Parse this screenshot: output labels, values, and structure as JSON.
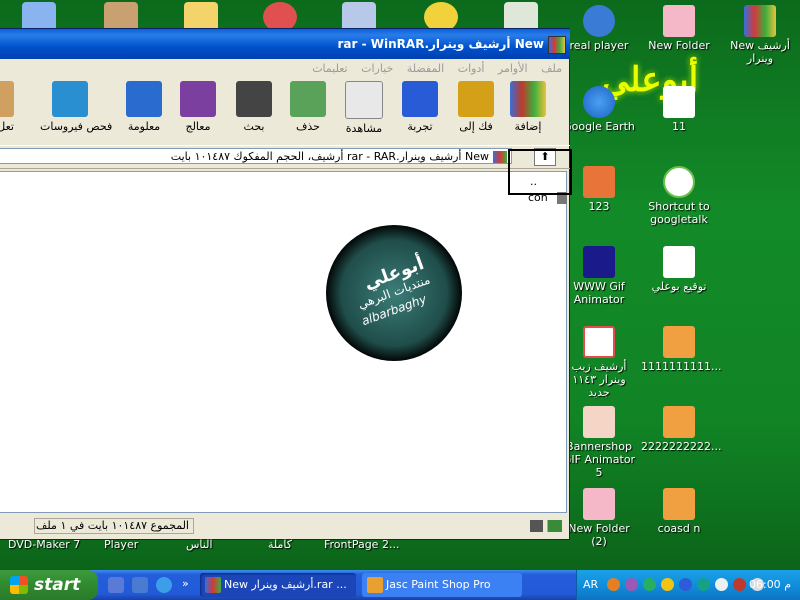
{
  "desktop": {
    "logo_text": "أبوعلي",
    "icons": [
      {
        "label": "real player",
        "color": "#3a7bd5"
      },
      {
        "label": "New Folder",
        "color": "#f4b8c9"
      },
      {
        "label": "New أرشيف وينرار",
        "color": "#8a4fd8"
      },
      {
        "label": "Google Earth",
        "color": "#1c62c8"
      },
      {
        "label": "11",
        "color": "#ffffff"
      },
      {
        "label": "123",
        "color": "#e8743a"
      },
      {
        "label": "Shortcut to googletalk",
        "color": "#6cc04a"
      },
      {
        "label": "WWW Gif Animator",
        "color": "#1a1a8a"
      },
      {
        "label": "توقيع بوعلي",
        "color": "#ffffff"
      },
      {
        "label": "أرشيف زيب وينرار ١١٤٣ جديد",
        "color": "#e84a4a"
      },
      {
        "label": "1111111111...",
        "color": "#f0a040"
      },
      {
        "label": "Bannershop GIF Animator 5",
        "color": "#f5d5c5"
      },
      {
        "label": "2222222222...",
        "color": "#f0a040"
      },
      {
        "label": "New Folder (2)",
        "color": "#f4b8c9"
      },
      {
        "label": "coasd n",
        "color": "#f0a040"
      }
    ],
    "quick_labels": [
      "DVD-Maker 7",
      "Player",
      "الناس",
      "كاملة",
      "FrontPage 2..."
    ]
  },
  "window": {
    "title": "New أرشيف وينرار.rar - WinRAR",
    "menu": [
      "ملف",
      "الأوامر",
      "أدوات",
      "المفضلة",
      "خيارات",
      "تعليمات"
    ],
    "toolbar": [
      {
        "label": "إضافة",
        "color": "#c0392b"
      },
      {
        "label": "فك إلى",
        "color": "#d4a017"
      },
      {
        "label": "تجربة",
        "color": "#2a5bd7"
      },
      {
        "label": "مشاهدة",
        "color": "#e8e8e8"
      },
      {
        "label": "حذف",
        "color": "#5aa15a"
      },
      {
        "label": "بحث",
        "color": "#444444"
      },
      {
        "label": "معالج",
        "color": "#7b3fa0"
      },
      {
        "label": "معلومة",
        "color": "#2a6bd0"
      },
      {
        "label": "فحص فيروسات",
        "color": "#2a8fd0"
      },
      {
        "label": "تعل",
        "color": "#d0a060"
      }
    ],
    "address": "New أرشيف وينرار.rar - RAR أرشيف، الحجم المفكوك ١٠١٤٨٧ بايت",
    "files": [
      "..",
      "con"
    ],
    "badge": {
      "line1": "أبوعلي",
      "line2": "منتديات البرهي",
      "line3": "albarbaghy"
    },
    "status": "المجموع ١٠١٤٨٧ بايت في ١ ملف"
  },
  "taskbar": {
    "start_label": "start",
    "tasks": [
      {
        "label": "New أرشيف وينرار.rar ...",
        "active": true,
        "color": "#8a4fd8"
      },
      {
        "label": "Jasc Paint Shop Pro",
        "active": false,
        "color": "#e8a030"
      }
    ],
    "language": "AR",
    "clock": "06:00 م",
    "accent": "#245edb"
  }
}
